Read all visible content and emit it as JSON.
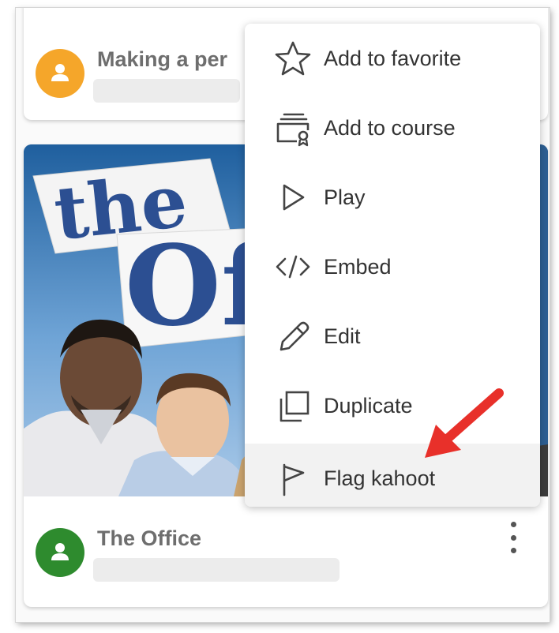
{
  "colors": {
    "avatar_orange": "#f5a62a",
    "avatar_green": "#2e8b2e",
    "title_text": "#6e6e6e",
    "menu_text": "#333333",
    "menu_highlight": "#f2f2f2",
    "annotation_arrow": "#e8302a"
  },
  "cards": {
    "top": {
      "title": "Making a per",
      "avatar_icon": "user-icon"
    },
    "main": {
      "title": "The Office",
      "avatar_icon": "user-icon",
      "cover_image": "the-office-cover-image",
      "more_icon": "kebab-menu-icon"
    }
  },
  "menu": {
    "items": [
      {
        "label": "Add to favorite",
        "icon": "star-icon"
      },
      {
        "label": "Add to course",
        "icon": "course-icon"
      },
      {
        "label": "Play",
        "icon": "play-icon"
      },
      {
        "label": "Embed",
        "icon": "code-icon"
      },
      {
        "label": "Edit",
        "icon": "pencil-icon"
      },
      {
        "label": "Duplicate",
        "icon": "duplicate-icon"
      },
      {
        "label": "Flag kahoot",
        "icon": "flag-icon",
        "highlighted": true
      }
    ]
  },
  "annotation": {
    "icon": "red-arrow-icon"
  }
}
